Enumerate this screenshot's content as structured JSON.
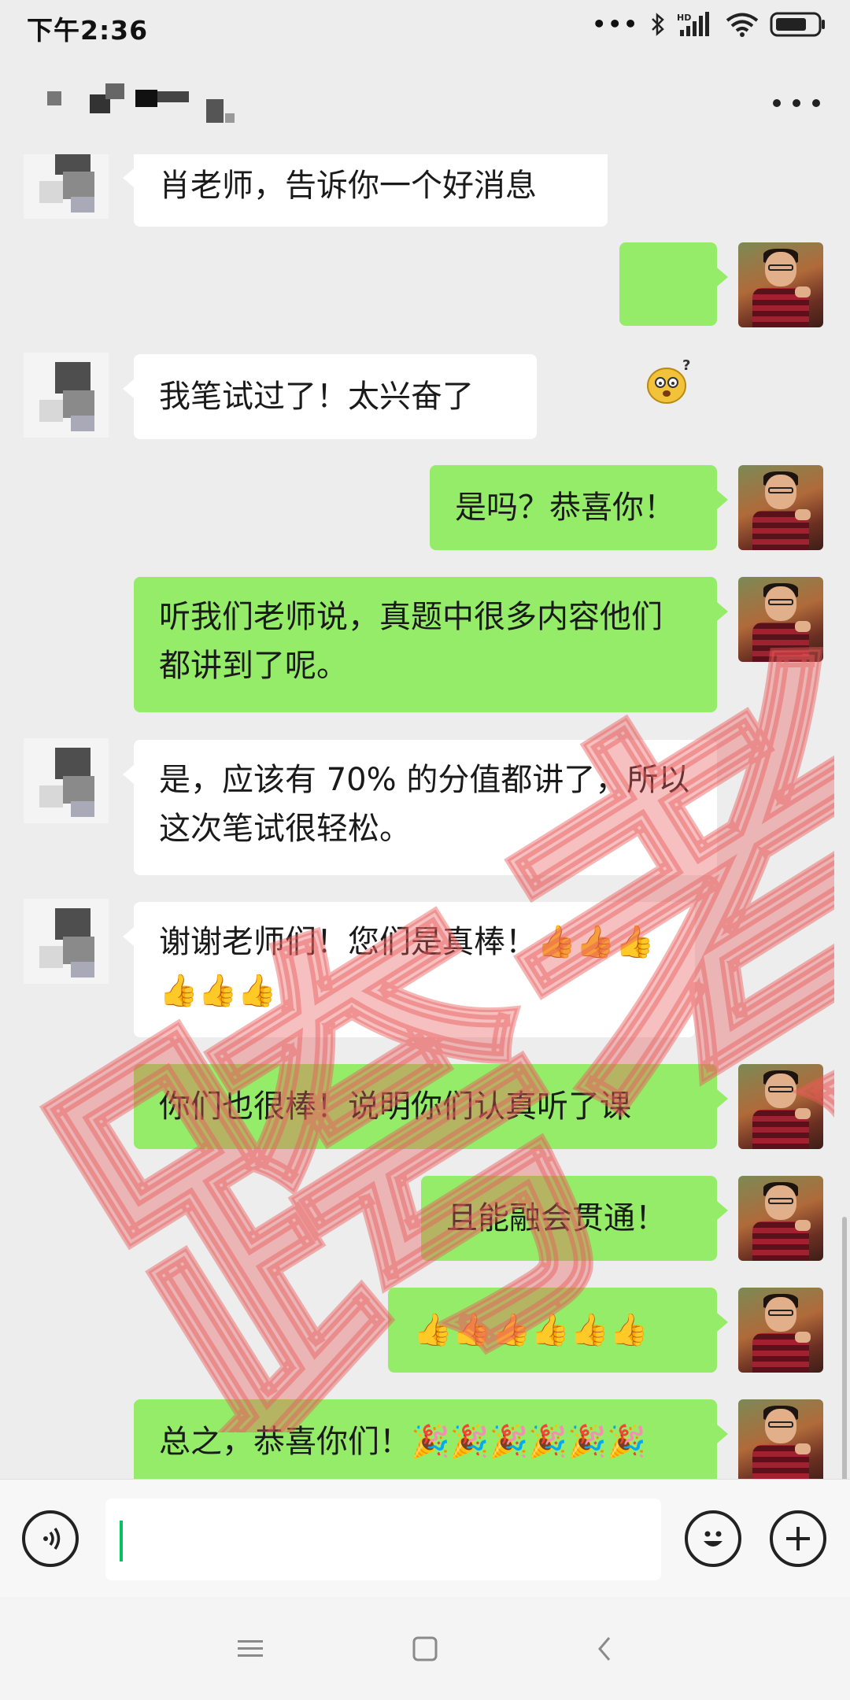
{
  "status_bar": {
    "time": "下午2:36",
    "icons": [
      "more-dots-icon",
      "bluetooth-icon",
      "hd-signal-icon",
      "wifi-icon",
      "battery-icon"
    ],
    "hd_label": "HD"
  },
  "header": {
    "contact_name": "",
    "menu_icon": "more-icon"
  },
  "messages": [
    {
      "side": "in",
      "text": "肖老师，告诉你一个好消息"
    },
    {
      "side": "out",
      "type": "sticker",
      "icon": "confused-face-sticker"
    },
    {
      "side": "in",
      "text": "我笔试过了！太兴奋了"
    },
    {
      "side": "out",
      "text": "是吗？恭喜你！"
    },
    {
      "side": "out",
      "text": "听我们老师说，真题中很多内容他们都讲到了呢。"
    },
    {
      "side": "in",
      "text": "是，应该有 70% 的分值都讲了，所以这次笔试很轻松。"
    },
    {
      "side": "in",
      "text": "谢谢老师们！您们是真棒！👍👍👍👍👍👍"
    },
    {
      "side": "out",
      "text": "你们也很棒！说明你们认真听了课"
    },
    {
      "side": "out",
      "text": "且能融会贯通！"
    },
    {
      "side": "out",
      "text": "👍👍👍👍👍👍"
    },
    {
      "side": "out",
      "text": "总之，恭喜你们！🎉🎉🎉🎉🎉🎉"
    }
  ],
  "watermark": {
    "text": "跨考",
    "color": "#e85a5a"
  },
  "input_bar": {
    "value": "",
    "voice_icon": "voice-icon",
    "emoji_icon": "emoji-icon",
    "plus_icon": "plus-icon"
  },
  "nav_bar": {
    "icons": [
      "menu-icon",
      "home-icon",
      "back-icon"
    ]
  },
  "colors": {
    "outgoing_bubble": "#95ec69",
    "incoming_bubble": "#ffffff",
    "background": "#ededed",
    "caret": "#07c160"
  }
}
